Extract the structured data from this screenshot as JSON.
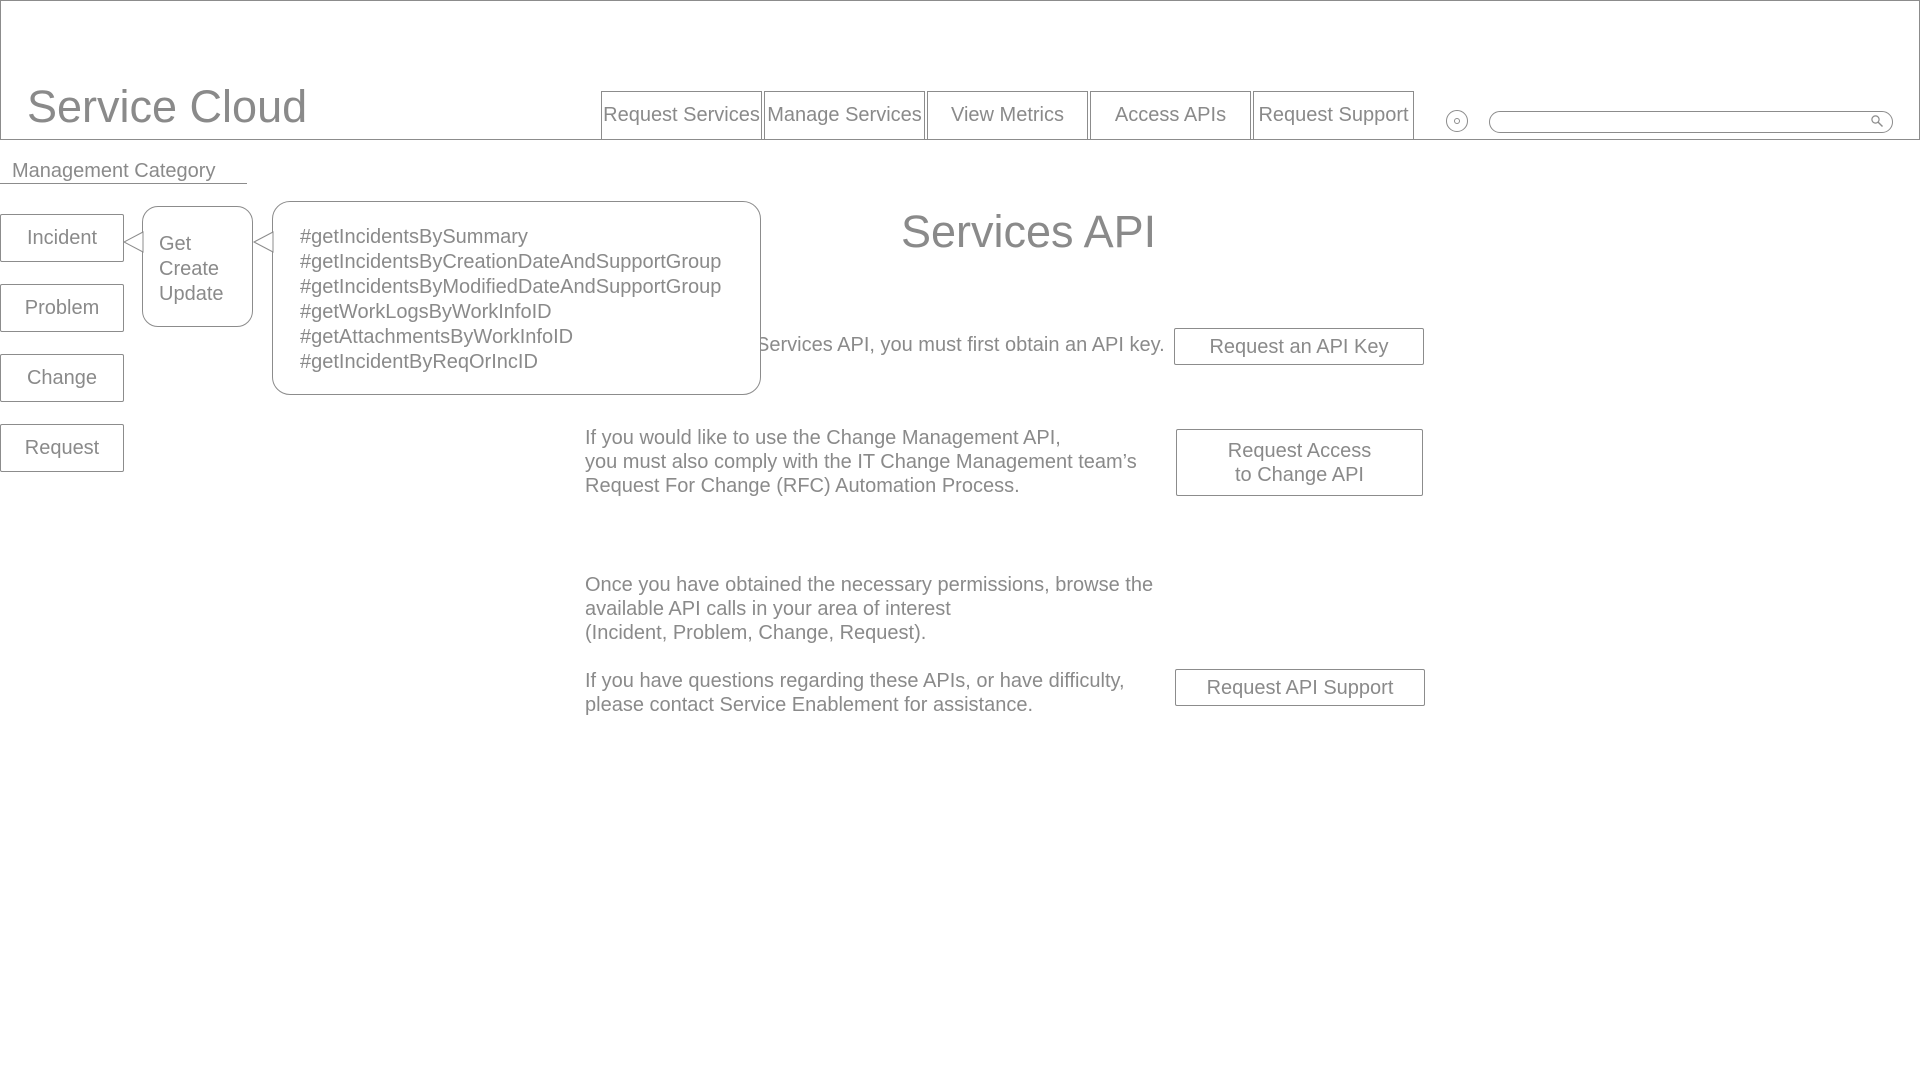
{
  "header": {
    "app_title": "Service Cloud",
    "nav_tabs": [
      {
        "label": "Request Services"
      },
      {
        "label": "Manage Services"
      },
      {
        "label": "View Metrics"
      },
      {
        "label": "Access APIs"
      },
      {
        "label": "Request Support"
      }
    ],
    "search": {
      "value": "",
      "placeholder": ""
    }
  },
  "sidebar": {
    "heading": "Management Category",
    "categories": [
      {
        "label": "Incident"
      },
      {
        "label": "Problem"
      },
      {
        "label": "Change"
      },
      {
        "label": "Request"
      }
    ],
    "operations": [
      "Get",
      "Create",
      "Update"
    ],
    "methods": [
      "#getIncidentsBySummary",
      "#getIncidentsByCreationDateAndSupportGroup",
      "#getIncidentsByModifiedDateAndSupportGroup",
      "#getWorkLogsByWorkInfoID",
      "#getAttachmentsByWorkInfoID",
      "#getIncidentByReqOrIncID"
    ]
  },
  "main": {
    "title": "Services API",
    "intro_visible": "Services API, you must first obtain an API key.",
    "paragraphs": {
      "change": [
        "If you would like to use the Change Management API,",
        "you must also comply with the IT Change Management team’s",
        "Request For Change (RFC) Automation Process."
      ],
      "browse": [
        "Once you have obtained the necessary permissions, browse the",
        "available API calls in your area of interest",
        "(Incident, Problem, Change, Request)."
      ],
      "support": [
        "If you have questions regarding these APIs, or have difficulty,",
        "please contact Service Enablement for assistance."
      ]
    },
    "buttons": {
      "api_key": "Request an API Key",
      "change_access": [
        "Request Access",
        "to Change API"
      ],
      "api_support": "Request API Support"
    }
  },
  "icons": {
    "settings": "settings-icon",
    "search": "search-icon"
  },
  "colors": {
    "stroke": "#8c8c8c",
    "text": "#8a8a8a",
    "background": "#ffffff"
  }
}
